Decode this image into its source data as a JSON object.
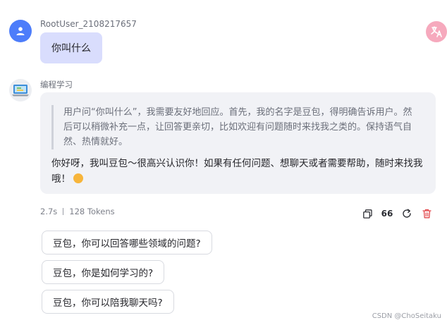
{
  "user": {
    "name": "RootUser_2108217657",
    "message": "你叫什么"
  },
  "bot": {
    "name": "编程学习",
    "thinking": "用户问“你叫什么”，我需要友好地回应。首先，我的名字是豆包，得明确告诉用户。然后可以稍微补充一点，让回答更亲切，比如欢迎有问题随时来找我之类的。保持语气自然、热情就好。",
    "answer": "你好呀，我叫豆包～很高兴认识你！如果有任何问题、想聊天或者需要帮助，随时来找我哦！",
    "emoji_icon": "smiling-face-emoji",
    "stats": {
      "time": "2.7s",
      "tokens": "128 Tokens"
    }
  },
  "actions": {
    "quote_label": "66",
    "icons": [
      "copy-icon",
      "quote-icon",
      "refresh-icon",
      "delete-icon"
    ]
  },
  "suggestions": [
    "豆包，你可以回答哪些领域的问题?",
    "豆包，你是如何学习的?",
    "豆包，你可以陪我聊天吗?"
  ],
  "watermark": "CSDN @ChoSeitaku",
  "colors": {
    "user_avatar": "#4d7dfa",
    "user_bubble": "#d9ddfd",
    "bot_card": "#f1f2f6",
    "translate_button": "#f6a9bd",
    "delete_icon": "#e2474b"
  }
}
